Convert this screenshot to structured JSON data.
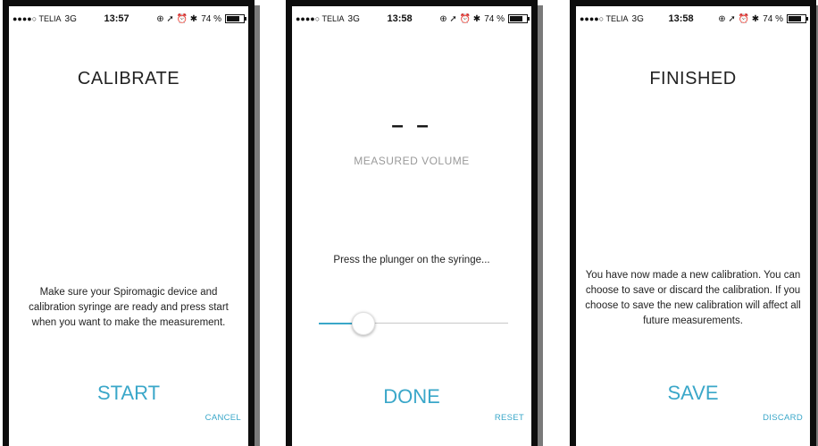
{
  "status_bars": [
    {
      "carrier": "●●●●○ TELIA",
      "network": "3G",
      "time": "13:57",
      "battery": "74 %",
      "icons": "⊕ ➚ ⏰ ✱"
    },
    {
      "carrier": "●●●●○ TELIA",
      "network": "3G",
      "time": "13:58",
      "battery": "74 %",
      "icons": "⊕ ➚ ⏰ ✱"
    },
    {
      "carrier": "●●●●○ TELIA",
      "network": "3G",
      "time": "13:58",
      "battery": "74 %",
      "icons": "⊕ ➚ ⏰ ✱"
    }
  ],
  "screen1": {
    "title": "CALIBRATE",
    "instructions": "Make sure your Spiromagic device and calibration syringe are ready and press start when you want to make the measurement.",
    "start_label": "START",
    "cancel_label": "CANCEL"
  },
  "screen2": {
    "value": "– –",
    "value_label": "MEASURED VOLUME",
    "prompt": "Press the plunger on the syringe...",
    "slider_fraction": 0.23,
    "done_label": "DONE",
    "reset_label": "RESET"
  },
  "screen3": {
    "title": "FINISHED",
    "message": "You have now made a new calibration. You can choose to save or discard the calibration. If you choose to save the new calibration will affect all future measurements.",
    "save_label": "SAVE",
    "discard_label": "DISCARD"
  },
  "colors": {
    "accent": "#3aa7c9",
    "frame": "#0d0d0d"
  }
}
